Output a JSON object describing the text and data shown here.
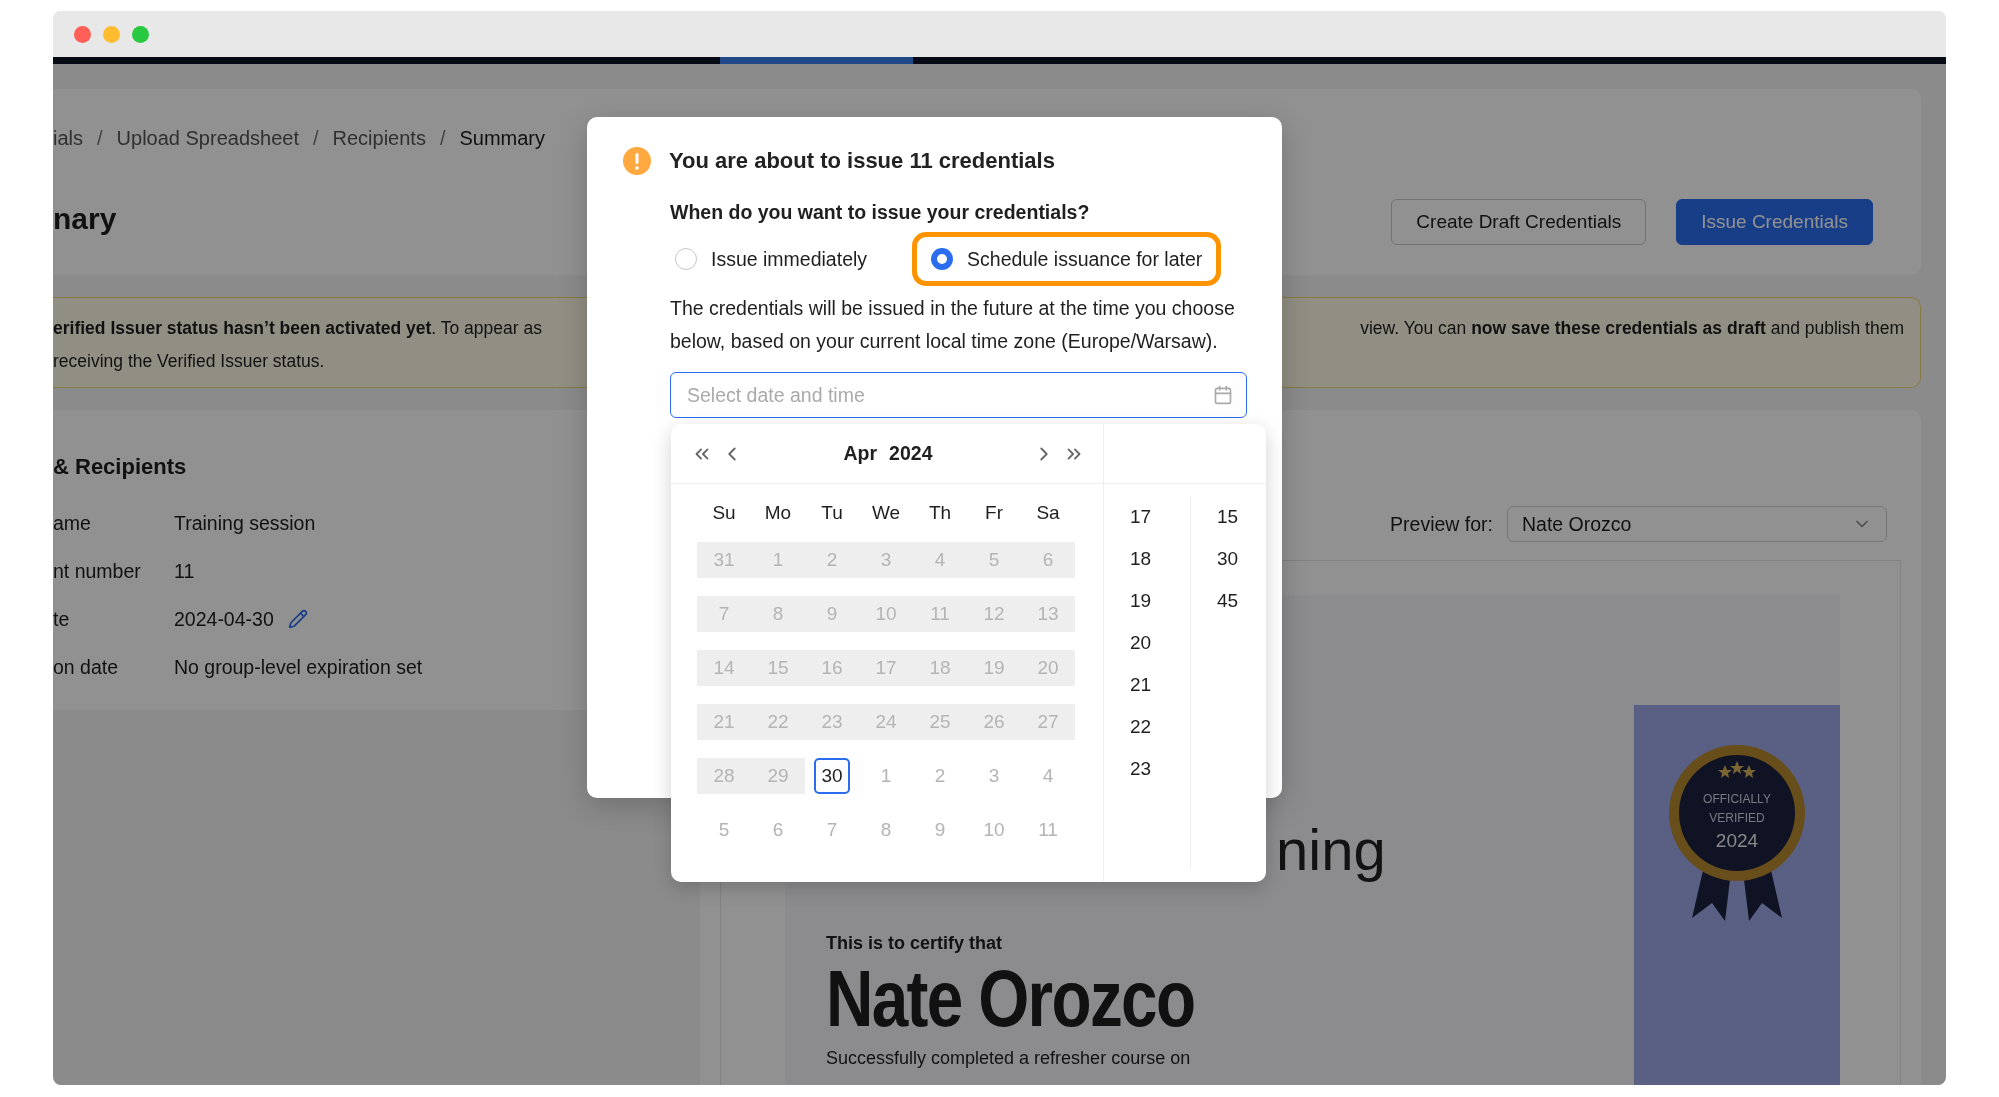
{
  "breadcrumb": [
    {
      "label": "ials",
      "current": false
    },
    {
      "label": "Upload Spreadsheet",
      "separator_before": "/",
      "current": false
    },
    {
      "label": "Recipients",
      "separator_before": "/",
      "current": false
    },
    {
      "label": "Summary",
      "separator_before": "/",
      "current": true
    }
  ],
  "page_title": "nary",
  "actions": [
    {
      "label": "Create Draft Credentials",
      "kind": "secondary"
    },
    {
      "label": "Issue Credentials",
      "kind": "primary"
    }
  ],
  "banner": {
    "left_lines": [
      "**erified Issuer status hasn’t been activated yet**. To appear as",
      "receiving the Verified Issuer status."
    ],
    "right_line": "view. You can **now save these credentials as draft** and publish them"
  },
  "details": {
    "title": "& Recipients",
    "rows": [
      {
        "label": "ame",
        "value": "Training session",
        "editable": false
      },
      {
        "label": "nt number",
        "value": "11",
        "editable": false
      },
      {
        "label": "te",
        "value": "2024-04-30",
        "editable": true
      },
      {
        "label": "on date",
        "value": "No group-level expiration set",
        "editable": false
      }
    ]
  },
  "preview": {
    "label": "Preview for:",
    "value": "Nate Orozco"
  },
  "certificate": {
    "title_fragment": "ning",
    "intro": "This is to certify that",
    "recipient": "Nate Orozco",
    "description": "Successfully completed a refresher course on",
    "badge": {
      "lines": [
        "OFFICIALLY",
        "VERIFIED"
      ],
      "year": "2024"
    }
  },
  "modal": {
    "title": "You are about to issue 11 credentials",
    "question": "When do you want to issue your credentials?",
    "options": [
      {
        "label": "Issue immediately",
        "selected": false,
        "highlighted": false
      },
      {
        "label": "Schedule issuance for later",
        "selected": true,
        "highlighted": true
      }
    ],
    "description": "The credentials will be issued in the future at the time you choose below, based on your current local time zone (Europe/Warsaw).",
    "date_field": {
      "placeholder": "Select date and time"
    }
  },
  "picker": {
    "month": "Apr",
    "year": "2024",
    "weekdays": [
      "Su",
      "Mo",
      "Tu",
      "We",
      "Th",
      "Fr",
      "Sa"
    ],
    "weeks": [
      [
        {
          "label": "31",
          "past": true,
          "disabled": true,
          "selected": false
        },
        {
          "label": "1",
          "past": true,
          "disabled": true,
          "selected": false
        },
        {
          "label": "2",
          "past": true,
          "disabled": true,
          "selected": false
        },
        {
          "label": "3",
          "past": true,
          "disabled": true,
          "selected": false
        },
        {
          "label": "4",
          "past": true,
          "disabled": true,
          "selected": false
        },
        {
          "label": "5",
          "past": true,
          "disabled": true,
          "selected": false
        },
        {
          "label": "6",
          "past": true,
          "disabled": true,
          "selected": false
        }
      ],
      [
        {
          "label": "7",
          "past": true,
          "disabled": true,
          "selected": false
        },
        {
          "label": "8",
          "past": true,
          "disabled": true,
          "selected": false
        },
        {
          "label": "9",
          "past": true,
          "disabled": true,
          "selected": false
        },
        {
          "label": "10",
          "past": true,
          "disabled": true,
          "selected": false
        },
        {
          "label": "11",
          "past": true,
          "disabled": true,
          "selected": false
        },
        {
          "label": "12",
          "past": true,
          "disabled": true,
          "selected": false
        },
        {
          "label": "13",
          "past": true,
          "disabled": true,
          "selected": false
        }
      ],
      [
        {
          "label": "14",
          "past": true,
          "disabled": true,
          "selected": false
        },
        {
          "label": "15",
          "past": true,
          "disabled": true,
          "selected": false
        },
        {
          "label": "16",
          "past": true,
          "disabled": true,
          "selected": false
        },
        {
          "label": "17",
          "past": true,
          "disabled": true,
          "selected": false
        },
        {
          "label": "18",
          "past": true,
          "disabled": true,
          "selected": false
        },
        {
          "label": "19",
          "past": true,
          "disabled": true,
          "selected": false
        },
        {
          "label": "20",
          "past": true,
          "disabled": true,
          "selected": false
        }
      ],
      [
        {
          "label": "21",
          "past": true,
          "disabled": true,
          "selected": false
        },
        {
          "label": "22",
          "past": true,
          "disabled": true,
          "selected": false
        },
        {
          "label": "23",
          "past": true,
          "disabled": true,
          "selected": false
        },
        {
          "label": "24",
          "past": true,
          "disabled": true,
          "selected": false
        },
        {
          "label": "25",
          "past": true,
          "disabled": true,
          "selected": false
        },
        {
          "label": "26",
          "past": true,
          "disabled": true,
          "selected": false
        },
        {
          "label": "27",
          "past": true,
          "disabled": true,
          "selected": false
        }
      ],
      [
        {
          "label": "28",
          "past": true,
          "disabled": true,
          "selected": false
        },
        {
          "label": "29",
          "past": true,
          "disabled": true,
          "selected": false
        },
        {
          "label": "30",
          "past": false,
          "disabled": false,
          "selected": true
        },
        {
          "label": "1",
          "past": false,
          "disabled": true,
          "selected": false
        },
        {
          "label": "2",
          "past": false,
          "disabled": true,
          "selected": false
        },
        {
          "label": "3",
          "past": false,
          "disabled": true,
          "selected": false
        },
        {
          "label": "4",
          "past": false,
          "disabled": true,
          "selected": false
        }
      ],
      [
        {
          "label": "5",
          "past": false,
          "disabled": true,
          "selected": false
        },
        {
          "label": "6",
          "past": false,
          "disabled": true,
          "selected": false
        },
        {
          "label": "7",
          "past": false,
          "disabled": true,
          "selected": false
        },
        {
          "label": "8",
          "past": false,
          "disabled": true,
          "selected": false
        },
        {
          "label": "9",
          "past": false,
          "disabled": true,
          "selected": false
        },
        {
          "label": "10",
          "past": false,
          "disabled": true,
          "selected": false
        },
        {
          "label": "11",
          "past": false,
          "disabled": true,
          "selected": false
        }
      ]
    ],
    "hours": [
      {
        "label": "17",
        "selected": false
      },
      {
        "label": "18",
        "selected": false
      },
      {
        "label": "19",
        "selected": false
      },
      {
        "label": "20",
        "selected": false
      },
      {
        "label": "21",
        "selected": false
      },
      {
        "label": "22",
        "selected": false
      },
      {
        "label": "23",
        "selected": false
      }
    ],
    "minutes": [
      {
        "label": "15",
        "selected": false
      },
      {
        "label": "30",
        "selected": false
      },
      {
        "label": "45",
        "selected": false
      }
    ]
  }
}
